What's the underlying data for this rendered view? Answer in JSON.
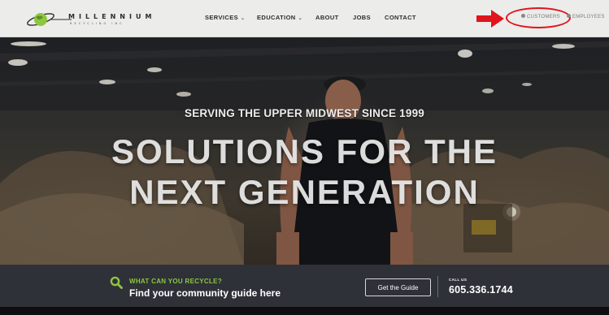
{
  "header": {
    "logo": {
      "name": "MILLENNIUM",
      "subtitle": "RECYCLING INC",
      "brand_green": "#8dc63f"
    },
    "nav": [
      {
        "label": "SERVICES",
        "has_dropdown": true
      },
      {
        "label": "EDUCATION",
        "has_dropdown": true
      },
      {
        "label": "ABOUT",
        "has_dropdown": false
      },
      {
        "label": "JOBS",
        "has_dropdown": false
      },
      {
        "label": "CONTACT",
        "has_dropdown": false
      }
    ],
    "chevron_glyph": "⌄",
    "portals": {
      "customers": "CUSTOMERS",
      "employees": "EMPLOYEES"
    },
    "annotation": {
      "arrow_color": "#e0141b",
      "ellipse_color": "#e0141b",
      "highlights": "customers"
    }
  },
  "hero": {
    "tagline": "SERVING THE UPPER MIDWEST SINCE 1999",
    "headline_line1": "SOLUTIONS FOR THE",
    "headline_line2": "NEXT GENERATION"
  },
  "cta": {
    "question": "WHAT CAN YOU RECYCLE?",
    "main": "Find your community guide here",
    "button": "Get the Guide",
    "call_label": "CALL US",
    "phone": "605.336.1744",
    "icon": "search-icon",
    "accent": "#8dc63f"
  }
}
